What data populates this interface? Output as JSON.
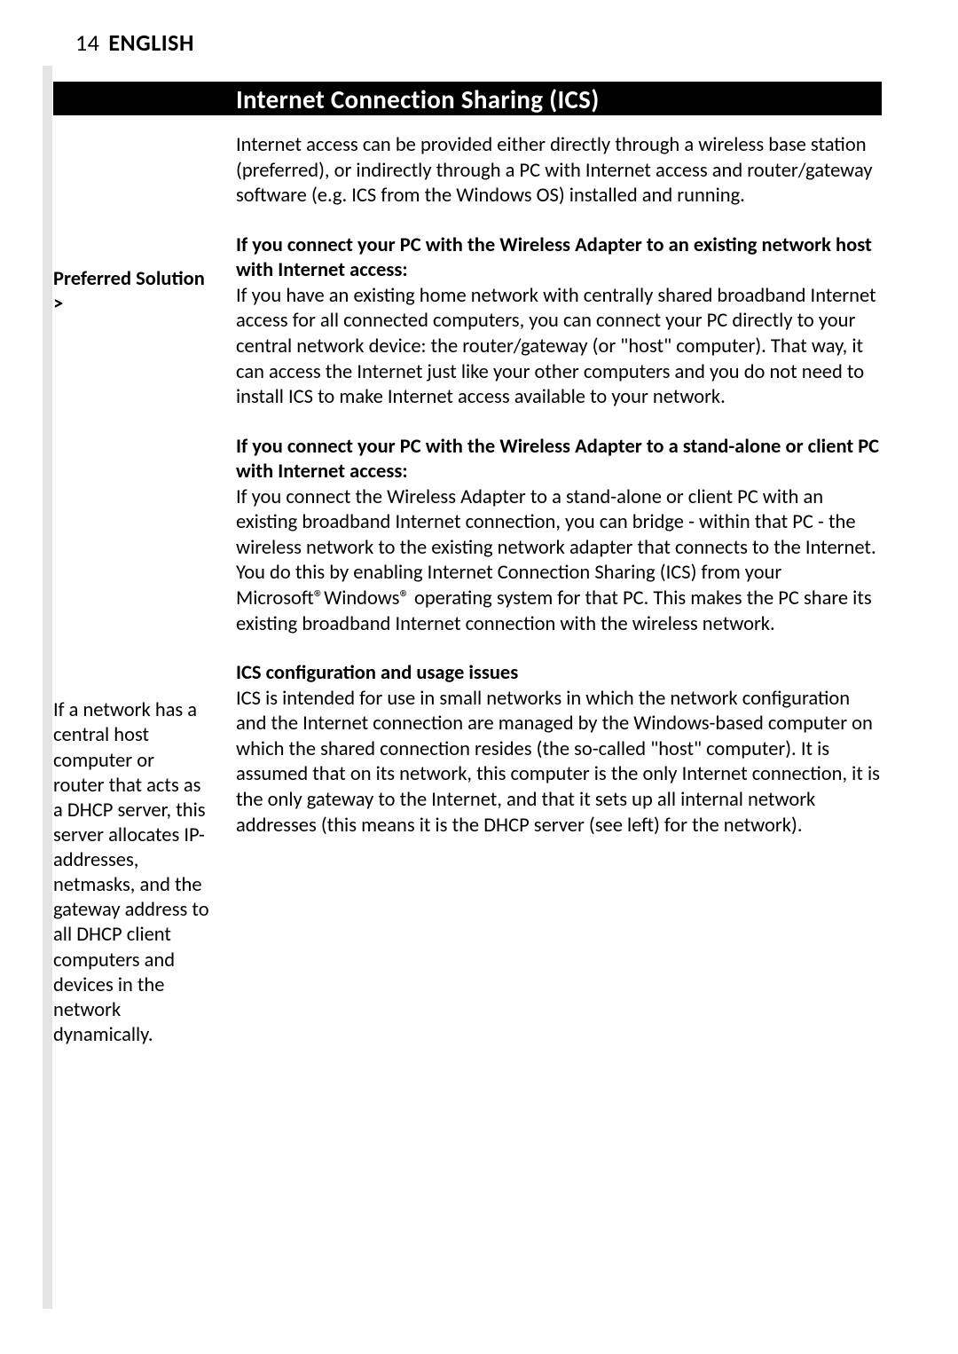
{
  "header": {
    "page_number": "14",
    "language": "ENGLISH"
  },
  "section_title": "Internet Connection Sharing (ICS)",
  "intro_paragraph": "Internet access can be provided either directly through a wireless base station (preferred), or indirectly through a PC with Internet access and router/gateway software (e.g. ICS from the Windows OS) installed and running.",
  "left_margin": {
    "preferred_solution": "Preferred Solution >",
    "dhcp_note_pre": "If a network has a central host computer or router that acts as a ",
    "dhcp_bold": "DHCP",
    "dhcp_note_post": " server, this server allocates IP-addresses, netmasks, and the gateway address to all DHCP client computers and devices in the network dynamically."
  },
  "sections": [
    {
      "heading": "If you connect your PC with the Wireless Adapter to an existing network host with Internet access:",
      "body": "If you have an existing home network with centrally shared broadband Internet access for all connected computers, you can connect your PC directly to your central network device: the router/gateway (or \"host\" computer). That way, it can access the Internet just like your other computers and you do not need to install ICS to make Internet access available to your network."
    },
    {
      "heading": "If you connect your PC with the Wireless Adapter to a stand-alone or client PC with Internet access:",
      "body": "If you connect the Wireless Adapter to a stand-alone or client PC with an existing broadband Internet connection, you can bridge - within that PC - the wireless network to the existing network adapter that connects to the Internet. You do this by enabling Internet Connection Sharing (ICS) from your Microsoft®Windows® operating system for that PC. This makes the PC share its existing broadband Internet connection with the wireless network."
    },
    {
      "heading": "ICS configuration and usage issues",
      "body": "ICS is intended for use in small networks in which the network configuration and the Internet connection are managed by the Windows-based computer on which the shared connection resides (the so-called \"host\" computer). It is assumed that on its network, this computer is the only Internet connection, it is the only gateway to the Internet, and that it sets up all internal network addresses (this means it is the DHCP server (see left) for the network)."
    }
  ]
}
